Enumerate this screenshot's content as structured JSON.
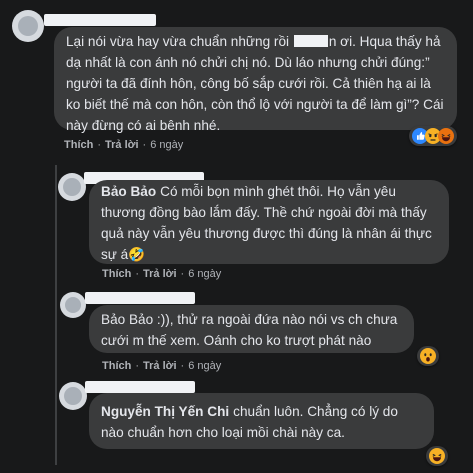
{
  "comments": [
    {
      "author": "",
      "text_before_redact": "Lại nói vừa hay vừa chuẩn những rồi",
      "text_after_redact": "n ơi. Hqua thấy hả dạ nhất là con ánh nó chửi chị nó. Dù láo nhưng chửi đúng:” người ta đã đính hôn, công bố sắp cưới rồi. Cả thiên hạ ai là ko biết thế mà con hôn, còn thổ lộ với người ta để làm gì”? Cái này đừng có ai bênh nhé.",
      "actions": {
        "like": "Thích",
        "reply": "Trả lời",
        "time": "6 ngày",
        "sep": "·"
      },
      "reactions": [
        "like",
        "angry",
        "haha"
      ]
    },
    {
      "author": "Bảo Bảo",
      "text": "Có mỗi bọn mình ghét thôi. Họ vẫn yêu thương đồng bào lắm đấy. Thề chứ ngoài đời mà thấy quả này vẫn yêu thương được thì đúng là nhân ái thực sự á🤣",
      "actions": {
        "like": "Thích",
        "reply": "Trả lời",
        "time": "6 ngày",
        "sep": "·"
      },
      "reactions": []
    },
    {
      "author": "",
      "text": "Bảo Bảo :)), thử ra ngoài đứa nào nói vs ch chưa cưới m thế xem. Oánh cho ko trượt phát nào",
      "actions": {
        "like": "Thích",
        "reply": "Trả lời",
        "time": "6 ngày",
        "sep": "·"
      },
      "reactions": [
        "wow"
      ]
    },
    {
      "author": "",
      "text_mention": "Nguyễn Thị Yến Chi",
      "text": "chuẩn luôn. Chẳng có lý do nào chuẩn hơn cho loại mồi chài này ca.",
      "actions": {
        "like": "Thích",
        "reply": "Trả lời",
        "time": "6 ngày",
        "sep": "·"
      },
      "reactions": [
        "haha"
      ]
    }
  ],
  "colors": {
    "background": "#18191a",
    "bubble": "#3a3b3c",
    "text": "#e4e6eb",
    "secondary": "#b0b3b8",
    "like_blue": "#2d88ff",
    "angry_orange": "#e9710f",
    "haha_yellow": "#f7b125"
  }
}
